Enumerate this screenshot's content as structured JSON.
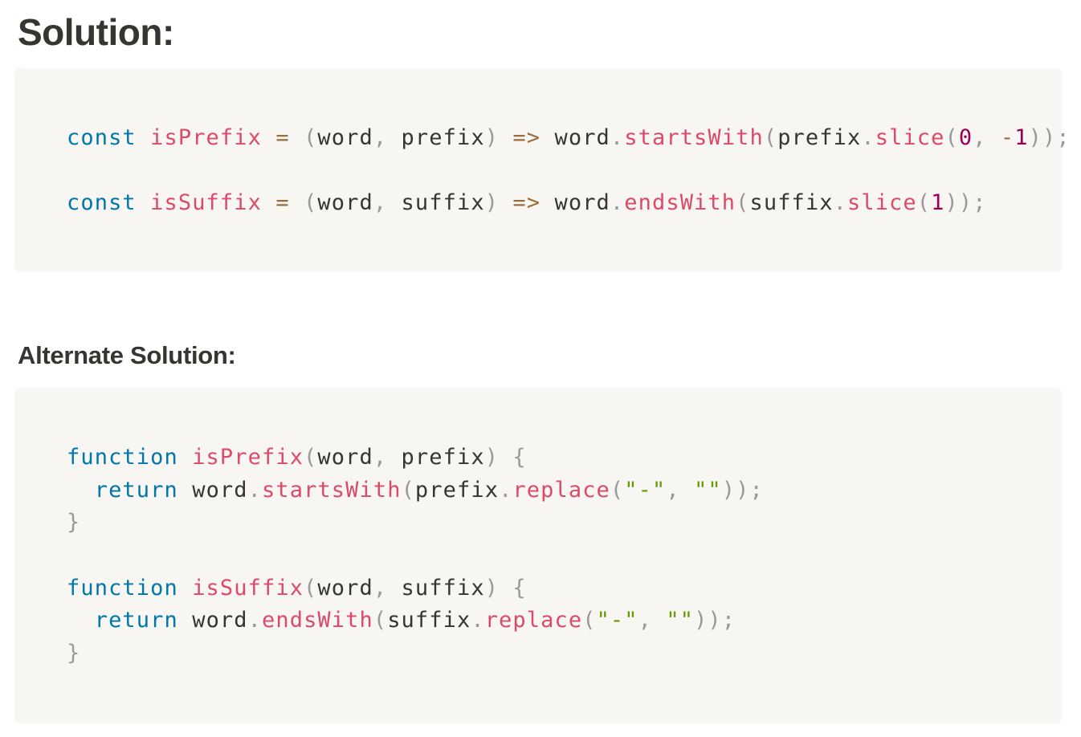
{
  "heading_main": "Solution:",
  "heading_alt": "Alternate Solution:",
  "code_block_1": {
    "lines": [
      [
        {
          "t": "const",
          "c": "kw"
        },
        {
          "t": " "
        },
        {
          "t": "isPrefix",
          "c": "fn"
        },
        {
          "t": " "
        },
        {
          "t": "=",
          "c": "op"
        },
        {
          "t": " "
        },
        {
          "t": "(",
          "c": "pn"
        },
        {
          "t": "word"
        },
        {
          "t": ",",
          "c": "pn"
        },
        {
          "t": " prefix"
        },
        {
          "t": ")",
          "c": "pn"
        },
        {
          "t": " "
        },
        {
          "t": "=>",
          "c": "op"
        },
        {
          "t": " word"
        },
        {
          "t": ".",
          "c": "pn"
        },
        {
          "t": "startsWith",
          "c": "fn"
        },
        {
          "t": "(",
          "c": "pn"
        },
        {
          "t": "prefix"
        },
        {
          "t": ".",
          "c": "pn"
        },
        {
          "t": "slice",
          "c": "fn"
        },
        {
          "t": "(",
          "c": "pn"
        },
        {
          "t": "0",
          "c": "nm"
        },
        {
          "t": ",",
          "c": "pn"
        },
        {
          "t": " "
        },
        {
          "t": "-",
          "c": "op"
        },
        {
          "t": "1",
          "c": "nm"
        },
        {
          "t": "));",
          "c": "pn"
        }
      ],
      [],
      [
        {
          "t": "const",
          "c": "kw"
        },
        {
          "t": " "
        },
        {
          "t": "isSuffix",
          "c": "fn"
        },
        {
          "t": " "
        },
        {
          "t": "=",
          "c": "op"
        },
        {
          "t": " "
        },
        {
          "t": "(",
          "c": "pn"
        },
        {
          "t": "word"
        },
        {
          "t": ",",
          "c": "pn"
        },
        {
          "t": " suffix"
        },
        {
          "t": ")",
          "c": "pn"
        },
        {
          "t": " "
        },
        {
          "t": "=>",
          "c": "op"
        },
        {
          "t": " word"
        },
        {
          "t": ".",
          "c": "pn"
        },
        {
          "t": "endsWith",
          "c": "fn"
        },
        {
          "t": "(",
          "c": "pn"
        },
        {
          "t": "suffix"
        },
        {
          "t": ".",
          "c": "pn"
        },
        {
          "t": "slice",
          "c": "fn"
        },
        {
          "t": "(",
          "c": "pn"
        },
        {
          "t": "1",
          "c": "nm"
        },
        {
          "t": "));",
          "c": "pn"
        }
      ]
    ]
  },
  "code_block_2": {
    "lines": [
      [
        {
          "t": "function",
          "c": "kw"
        },
        {
          "t": " "
        },
        {
          "t": "isPrefix",
          "c": "fn"
        },
        {
          "t": "(",
          "c": "pn"
        },
        {
          "t": "word"
        },
        {
          "t": ",",
          "c": "pn"
        },
        {
          "t": " prefix"
        },
        {
          "t": ")",
          "c": "pn"
        },
        {
          "t": " "
        },
        {
          "t": "{",
          "c": "pn"
        }
      ],
      [
        {
          "t": "  "
        },
        {
          "t": "return",
          "c": "kw"
        },
        {
          "t": " word"
        },
        {
          "t": ".",
          "c": "pn"
        },
        {
          "t": "startsWith",
          "c": "fn"
        },
        {
          "t": "(",
          "c": "pn"
        },
        {
          "t": "prefix"
        },
        {
          "t": ".",
          "c": "pn"
        },
        {
          "t": "replace",
          "c": "fn"
        },
        {
          "t": "(",
          "c": "pn"
        },
        {
          "t": "\"-\"",
          "c": "st"
        },
        {
          "t": ",",
          "c": "pn"
        },
        {
          "t": " "
        },
        {
          "t": "\"\"",
          "c": "st"
        },
        {
          "t": "));",
          "c": "pn"
        }
      ],
      [
        {
          "t": "}",
          "c": "pn"
        }
      ],
      [],
      [
        {
          "t": "function",
          "c": "kw"
        },
        {
          "t": " "
        },
        {
          "t": "isSuffix",
          "c": "fn"
        },
        {
          "t": "(",
          "c": "pn"
        },
        {
          "t": "word"
        },
        {
          "t": ",",
          "c": "pn"
        },
        {
          "t": " suffix"
        },
        {
          "t": ")",
          "c": "pn"
        },
        {
          "t": " "
        },
        {
          "t": "{",
          "c": "pn"
        }
      ],
      [
        {
          "t": "  "
        },
        {
          "t": "return",
          "c": "kw"
        },
        {
          "t": " word"
        },
        {
          "t": ".",
          "c": "pn"
        },
        {
          "t": "endsWith",
          "c": "fn"
        },
        {
          "t": "(",
          "c": "pn"
        },
        {
          "t": "suffix"
        },
        {
          "t": ".",
          "c": "pn"
        },
        {
          "t": "replace",
          "c": "fn"
        },
        {
          "t": "(",
          "c": "pn"
        },
        {
          "t": "\"-\"",
          "c": "st"
        },
        {
          "t": ",",
          "c": "pn"
        },
        {
          "t": " "
        },
        {
          "t": "\"\"",
          "c": "st"
        },
        {
          "t": "));",
          "c": "pn"
        }
      ],
      [
        {
          "t": "}",
          "c": "pn"
        }
      ]
    ]
  },
  "colors": {
    "keyword": "#0077aa",
    "function": "#dd4a68",
    "operator": "#9a6e3a",
    "punctuation": "#999999",
    "number": "#990055",
    "string": "#669900",
    "code_background": "#f7f6f3",
    "text": "#37352f"
  }
}
